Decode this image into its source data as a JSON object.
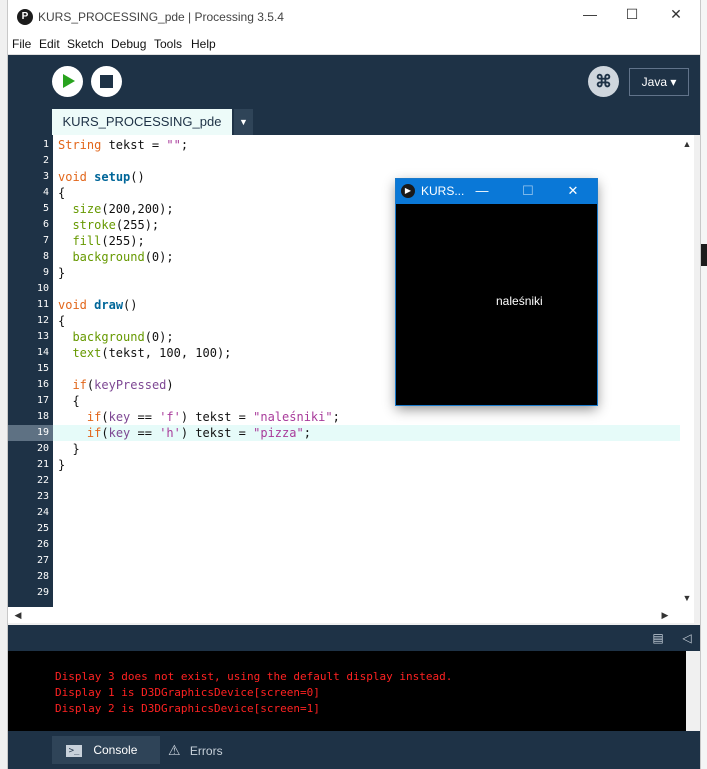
{
  "window": {
    "title": "KURS_PROCESSING_pde | Processing 3.5.4",
    "app_icon": "P",
    "controls": {
      "minimize": "—",
      "maximize": "☐",
      "close": "✕"
    }
  },
  "menu": [
    "File",
    "Edit",
    "Sketch",
    "Debug",
    "Tools",
    "Help"
  ],
  "toolbar": {
    "run_icon": "play-icon",
    "stop_icon": "stop-icon",
    "debug_glyph": "⌘",
    "mode_label": "Java ▾"
  },
  "tab": {
    "label": "KURS_PROCESSING_pde",
    "menu_arrow": "▼"
  },
  "editor": {
    "line_numbers": [
      "1",
      "2",
      "3",
      "4",
      "5",
      "6",
      "7",
      "8",
      "9",
      "10",
      "11",
      "12",
      "13",
      "14",
      "15",
      "16",
      "17",
      "18",
      "19",
      "20",
      "21",
      "22",
      "23",
      "24",
      "25",
      "26",
      "27",
      "28",
      "29"
    ],
    "current_line": "19",
    "code": [
      "String tekst = \"\";",
      "",
      "void setup()",
      "{",
      "  size(200,200);",
      "  stroke(255);",
      "  fill(255);",
      "  background(0);",
      "}",
      "",
      "void draw()",
      "{",
      "  background(0);",
      "  text(tekst, 100, 100);",
      "",
      "  if(keyPressed)",
      "  {",
      "    if(key == 'f') tekst = \"naleśniki\";",
      "    if(key == 'h') tekst = \"pizza\";",
      "  }",
      "}",
      "",
      "",
      "",
      "",
      "",
      "",
      "",
      ""
    ]
  },
  "sketch_window": {
    "title": "KURS...",
    "controls": {
      "minimize": "—",
      "maximize": "☐",
      "close": "✕"
    },
    "canvas_text": "naleśniki"
  },
  "console": {
    "lines": [
      "Display 3 does not exist, using the default display instead.",
      "Display 1 is D3DGraphicsDevice[screen=0]",
      "Display 2 is D3DGraphicsDevice[screen=1]"
    ]
  },
  "footer": {
    "console_tab": "Console",
    "errors_tab": "Errors"
  },
  "colors": {
    "toolbar_bg": "#1e3246",
    "run_green": "#28a31e",
    "console_error": "#ff2222",
    "sketch_titlebar": "#0a78d7"
  }
}
